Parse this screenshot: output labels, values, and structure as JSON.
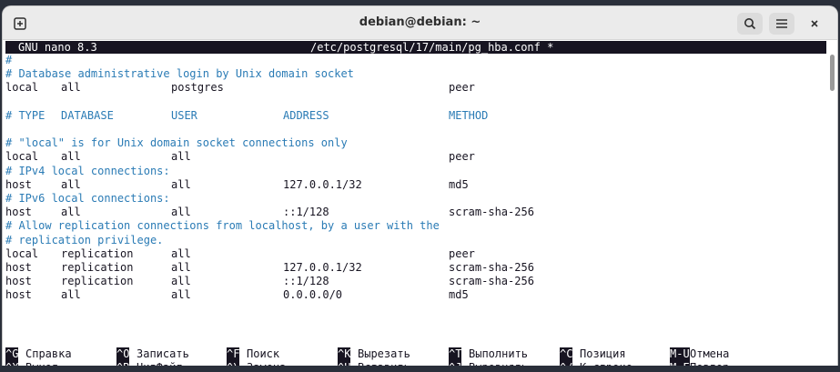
{
  "window": {
    "title": "debian@debian: ~"
  },
  "nano": {
    "app_version": "GNU nano 8.3",
    "file_path": "/etc/postgresql/17/main/pg_hba.conf *"
  },
  "lines": [
    {
      "type": "comment",
      "text": "#"
    },
    {
      "type": "comment",
      "text": "# Database administrative login by Unix domain socket"
    },
    {
      "type": "entry",
      "cols": [
        "local",
        "all",
        "postgres",
        "",
        "peer"
      ]
    },
    {
      "type": "blank"
    },
    {
      "type": "comment-header",
      "cols": [
        "# TYPE",
        "DATABASE",
        "USER",
        "ADDRESS",
        "METHOD"
      ]
    },
    {
      "type": "blank"
    },
    {
      "type": "comment",
      "text": "# \"local\" is for Unix domain socket connections only"
    },
    {
      "type": "entry",
      "cols": [
        "local",
        "all",
        "all",
        "",
        "peer"
      ]
    },
    {
      "type": "comment",
      "text": "# IPv4 local connections:"
    },
    {
      "type": "entry",
      "cols": [
        "host",
        "all",
        "all",
        "127.0.0.1/32",
        "md5"
      ]
    },
    {
      "type": "comment",
      "text": "# IPv6 local connections:"
    },
    {
      "type": "entry",
      "cols": [
        "host",
        "all",
        "all",
        "::1/128",
        "scram-sha-256"
      ]
    },
    {
      "type": "comment",
      "text": "# Allow replication connections from localhost, by a user with the"
    },
    {
      "type": "comment",
      "text": "# replication privilege."
    },
    {
      "type": "entry",
      "cols": [
        "local",
        "replication",
        "all",
        "",
        "peer"
      ]
    },
    {
      "type": "entry",
      "cols": [
        "host",
        "replication",
        "all",
        "127.0.0.1/32",
        "scram-sha-256"
      ]
    },
    {
      "type": "entry",
      "cols": [
        "host",
        "replication",
        "all",
        "::1/128",
        "scram-sha-256"
      ]
    },
    {
      "type": "entry",
      "cols": [
        "host",
        "all",
        "all",
        "0.0.0.0/0",
        "md5"
      ]
    }
  ],
  "shortcuts": [
    [
      {
        "key": "^G",
        "label": "Справка"
      },
      {
        "key": "^O",
        "label": "Записать"
      },
      {
        "key": "^F",
        "label": "Поиск"
      },
      {
        "key": "^K",
        "label": "Вырезать"
      },
      {
        "key": "^T",
        "label": "Выполнить"
      },
      {
        "key": "^C",
        "label": "Позиция"
      },
      {
        "key": "M-U",
        "label": "Отмена"
      }
    ],
    [
      {
        "key": "^X",
        "label": "Выход"
      },
      {
        "key": "^R",
        "label": "ЧитФайл"
      },
      {
        "key": "^\\",
        "label": "Замена"
      },
      {
        "key": "^U",
        "label": "Вставить"
      },
      {
        "key": "^J",
        "label": "Выровнять"
      },
      {
        "key": "^/",
        "label": "К строке"
      },
      {
        "key": "M-E",
        "label": "Повтор"
      }
    ]
  ],
  "colors": {
    "comment": "#2a7bb5",
    "text": "#171421",
    "background": "#ffffff",
    "inverse_bg": "#171421"
  },
  "icons": {
    "new_tab": "new-tab-icon",
    "search": "search-icon",
    "menu": "hamburger-menu-icon",
    "close": "close-icon"
  }
}
